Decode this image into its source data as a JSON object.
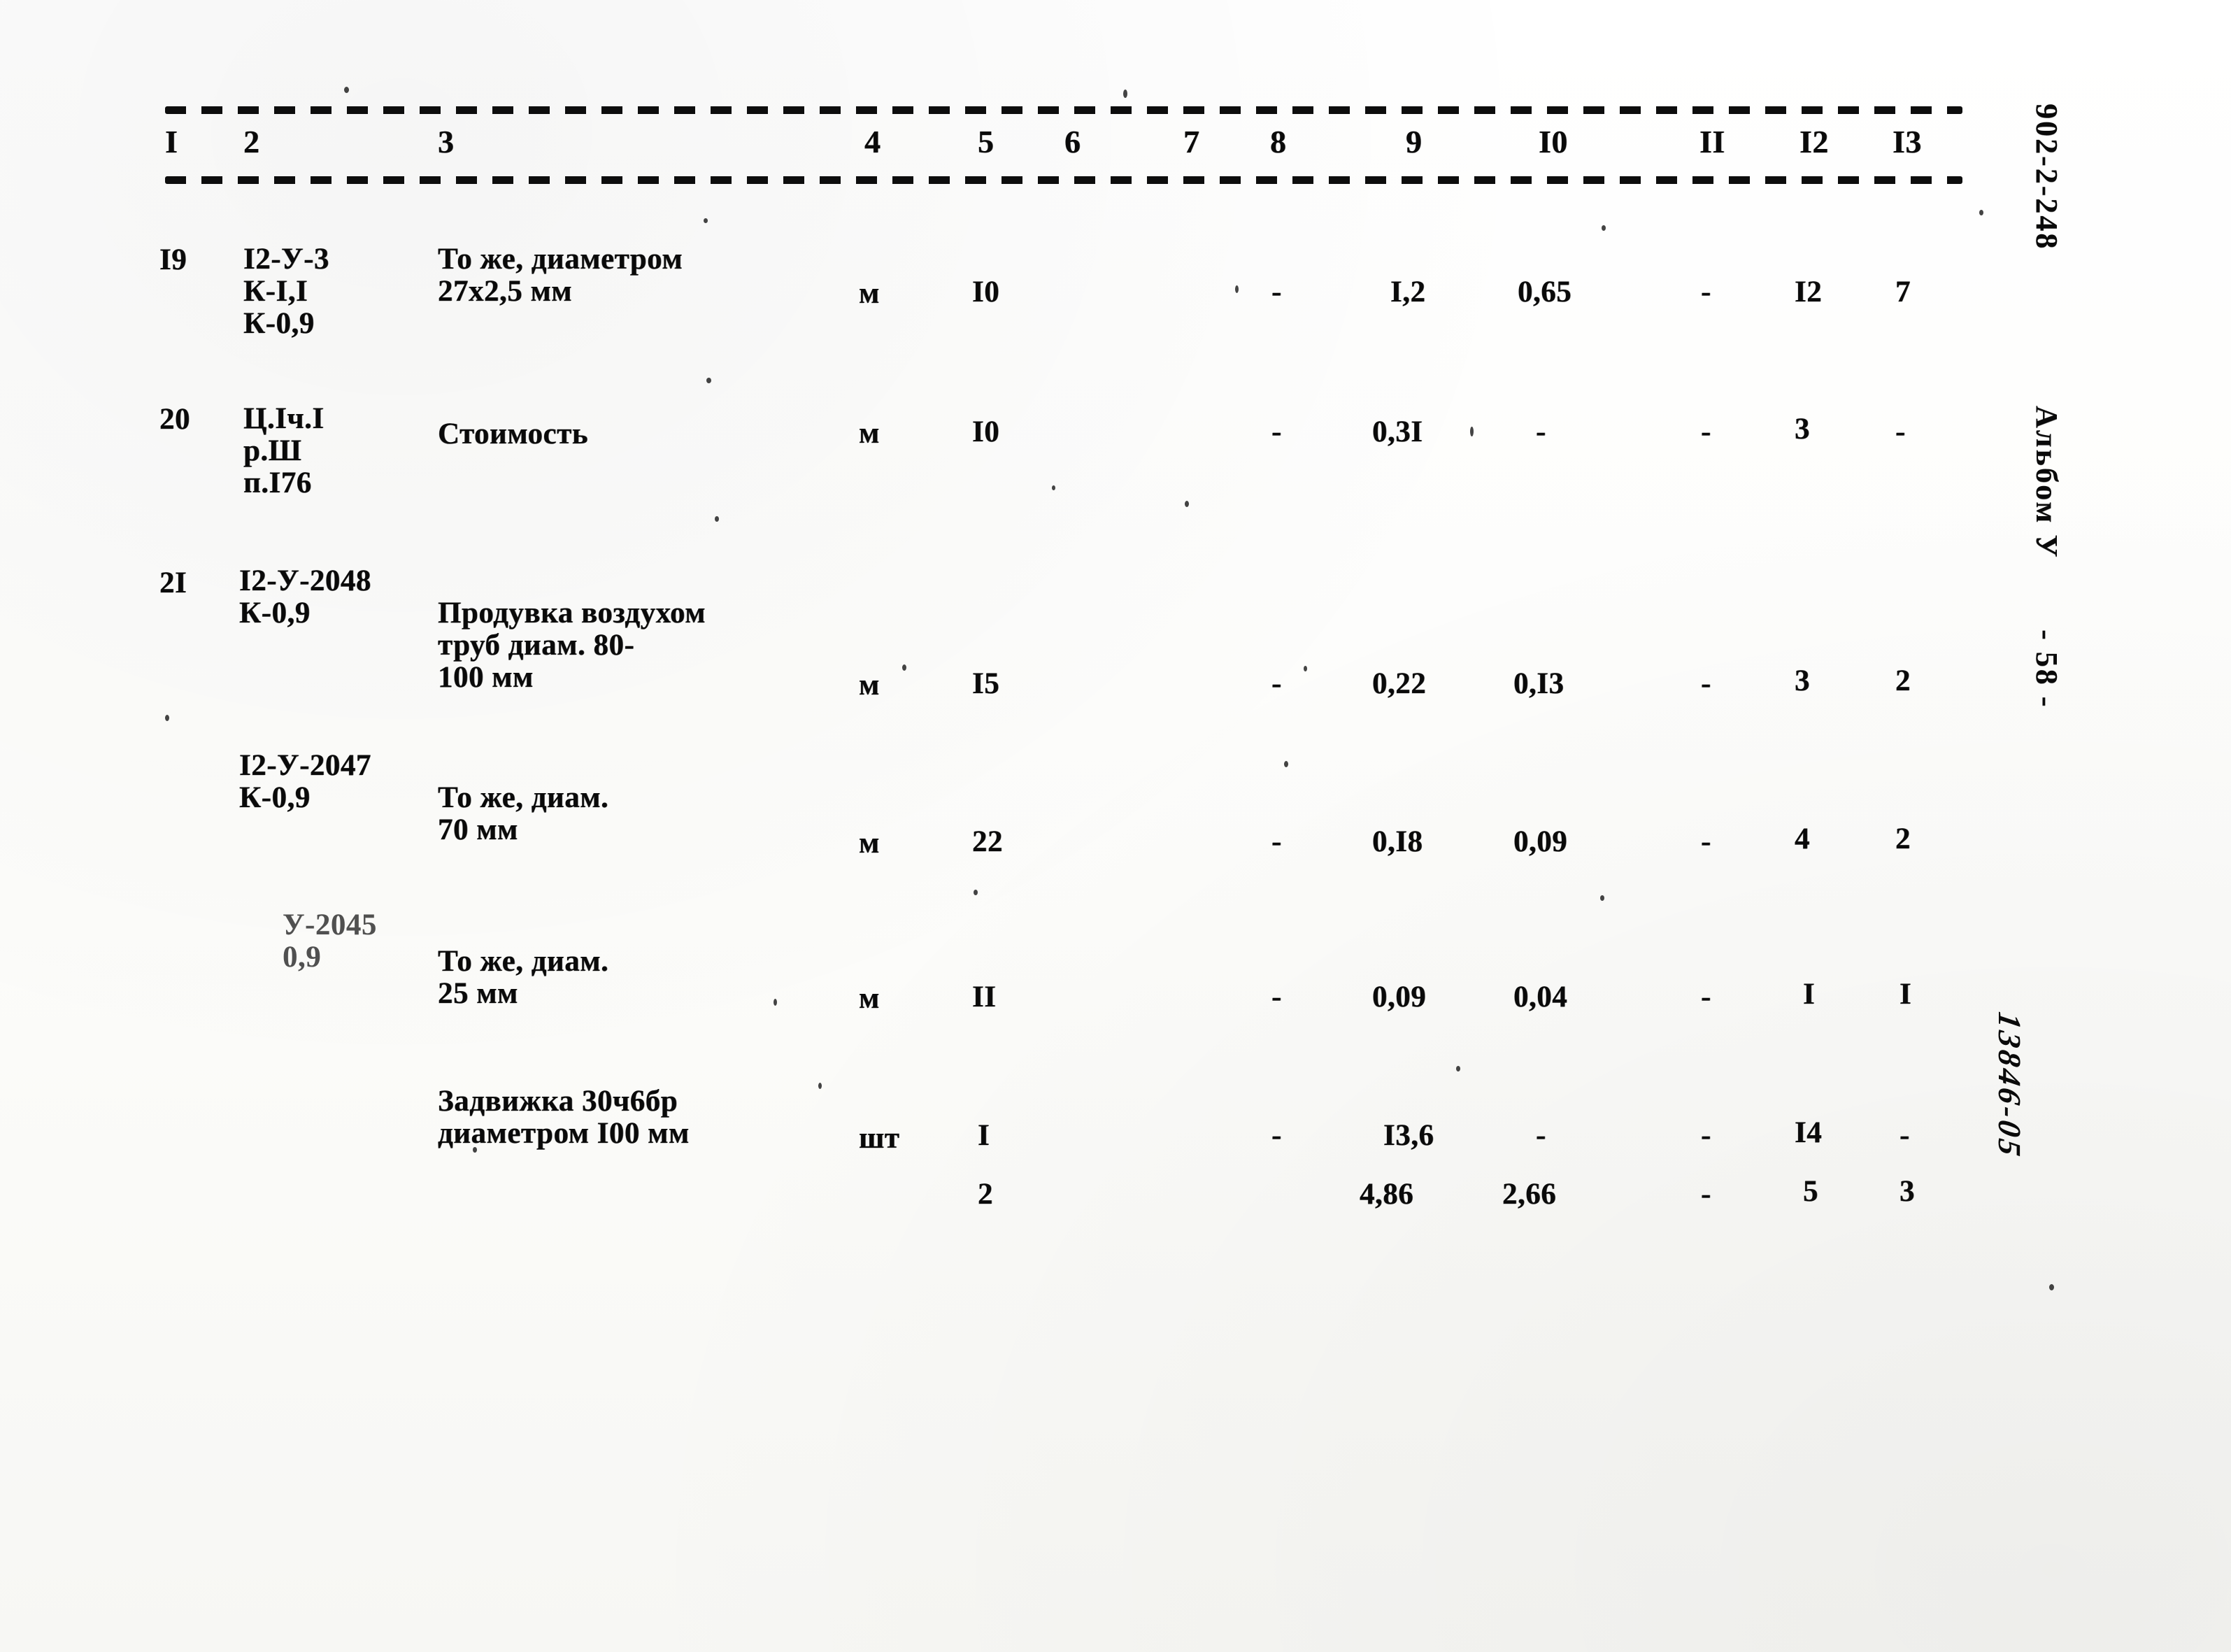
{
  "document": {
    "sheet_code": "902-2-248",
    "album_label": "Альбом У",
    "page_label": "- 58 -",
    "archive_stamp": "13846-05"
  },
  "table": {
    "column_headers": [
      "I",
      "2",
      "3",
      "4",
      "5",
      "6",
      "7",
      "8",
      "9",
      "I0",
      "II",
      "I2",
      "I3"
    ],
    "rows": [
      {
        "num": "I9",
        "code": "I2-У-3\nК-I,I\nК-0,9",
        "description": "То же, диаметром\n27х2,5 мм",
        "unit": "м",
        "qty": "I0",
        "c6": "",
        "c7": "",
        "c8": "-",
        "c9": "I,2",
        "c10": "0,65",
        "c11": "-",
        "c12": "I2",
        "c13": "7"
      },
      {
        "num": "20",
        "code": "Ц.Iч.I\nр.Ш\nп.I76",
        "description": "Стоимость",
        "unit": "м",
        "qty": "I0",
        "c6": "",
        "c7": "",
        "c8": "-",
        "c9": "0,3I",
        "c10": "-",
        "c11": "-",
        "c12": "3",
        "c13": "-"
      },
      {
        "num": "2I",
        "code": "I2-У-2048\nК-0,9",
        "description": "Продувка воздухом\nтруб диам. 80-\n100 мм",
        "unit": "м",
        "qty": "I5",
        "c6": "",
        "c7": "",
        "c8": "-",
        "c9": "0,22",
        "c10": "0,I3",
        "c11": "-",
        "c12": "3",
        "c13": "2"
      },
      {
        "num": "",
        "code": "I2-У-2047\nК-0,9",
        "description": "То же, диам.\n70 мм",
        "unit": "м",
        "qty": "22",
        "c6": "",
        "c7": "",
        "c8": "-",
        "c9": "0,I8",
        "c10": "0,09",
        "c11": "-",
        "c12": "4",
        "c13": "2"
      },
      {
        "num": "",
        "code": "У-2045\n0,9",
        "description": "То же, диам.\n25 мм",
        "unit": "м",
        "qty": "II",
        "c6": "",
        "c7": "",
        "c8": "-",
        "c9": "0,09",
        "c10": "0,04",
        "c11": "-",
        "c12": "I",
        "c13": "I"
      },
      {
        "num": "",
        "code": "",
        "description": "Задвижка 30ч6бр\nдиаметром I00 мм",
        "unit": "шт",
        "qty": "I",
        "c6": "",
        "c7": "",
        "c8": "-",
        "c9": "I3,6",
        "c10": "-",
        "c11": "-",
        "c12": "I4",
        "c13": "-"
      },
      {
        "num": "",
        "code": "",
        "description": "",
        "unit": "",
        "qty": "2",
        "c6": "",
        "c7": "",
        "c8": "",
        "c9": "4,86",
        "c10": "2,66",
        "c11": "-",
        "c12": "5",
        "c13": "3"
      }
    ]
  }
}
